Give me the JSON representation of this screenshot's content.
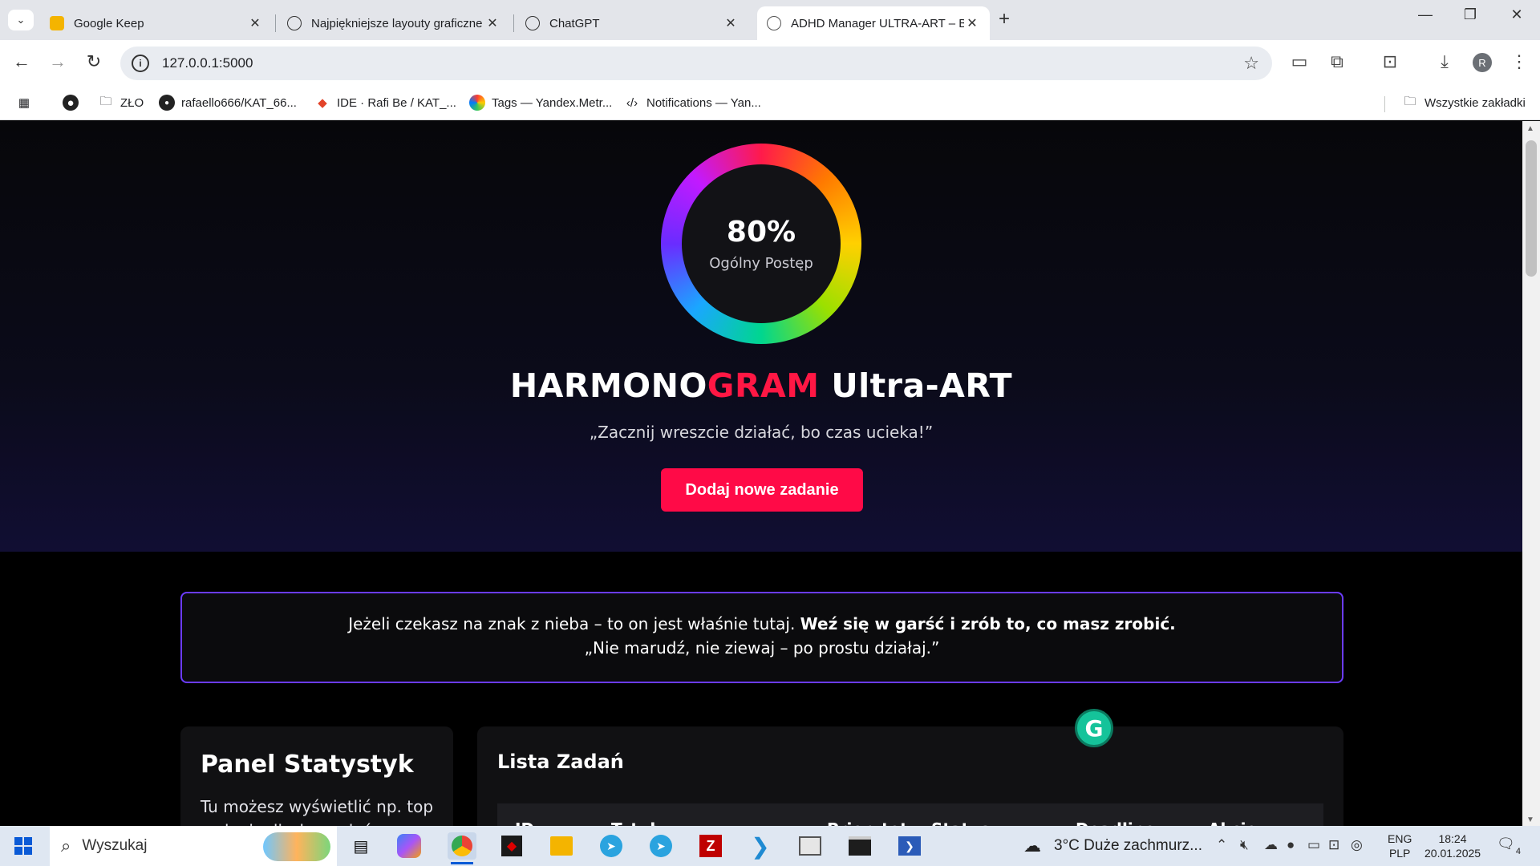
{
  "browser": {
    "tabs": [
      {
        "title": "Google Keep",
        "icon": "keep-icon"
      },
      {
        "title": "Najpiękniejsze layouty graficzne",
        "icon": "chatgpt-icon"
      },
      {
        "title": "ChatGPT",
        "icon": "chatgpt-icon"
      },
      {
        "title": "ADHD Manager ULTRA-ART – B",
        "icon": "globe-icon"
      }
    ],
    "url": "127.0.0.1:5000",
    "avatar_letter": "R",
    "bookmarks": [
      {
        "label": "ZŁO",
        "icon": "folder-icon"
      },
      {
        "label": "rafaello666/KAT_66...",
        "icon": "github-icon"
      },
      {
        "label": "IDE · Rafi Be / KAT_...",
        "icon": "gitlab-icon"
      },
      {
        "label": "Tags — Yandex.Metr...",
        "icon": "yandex-metrica-icon"
      },
      {
        "label": "Notifications — Yan...",
        "icon": "code-icon"
      }
    ],
    "all_bookmarks_label": "Wszystkie zakładki"
  },
  "page": {
    "progress_percent": 80,
    "progress_text": "80%",
    "progress_label": "Ogólny Postęp",
    "title_part1": "HARMONO",
    "title_part2": "GRAM",
    "title_part3": " Ultra-ART",
    "tagline": "„Zacznij wreszcie działać, bo czas ucieka!”",
    "add_button": "Dodaj nowe zadanie",
    "quote_plain": "Jeżeli czekasz na znak z nieba – to on jest właśnie tutaj. ",
    "quote_bold": "Weź się w garść i zrób to, co masz zrobić.",
    "quote_line2": "„Nie marudź, nie ziewaj – po prostu działaj.”",
    "stats_title": "Panel Statystyk",
    "stats_text": "Tu możesz wyświetlić np. top zadania, liczbę zadań...",
    "tasks_title": "Lista Zadań",
    "table_headers": [
      "ID",
      "Tytuł",
      "Priorytet",
      "Status",
      "Deadline",
      "Akcje"
    ],
    "grammarly_letter": "G",
    "colors": {
      "accent": "#ff0a47",
      "border": "#6b3bff"
    }
  },
  "taskbar": {
    "search_placeholder": "Wyszukaj",
    "weather": "3°C  Duże zachmurz...",
    "lang_top": "ENG",
    "lang_bottom": "PLP",
    "time": "18:24",
    "date": "20.01.2025",
    "notif_count": "4"
  }
}
